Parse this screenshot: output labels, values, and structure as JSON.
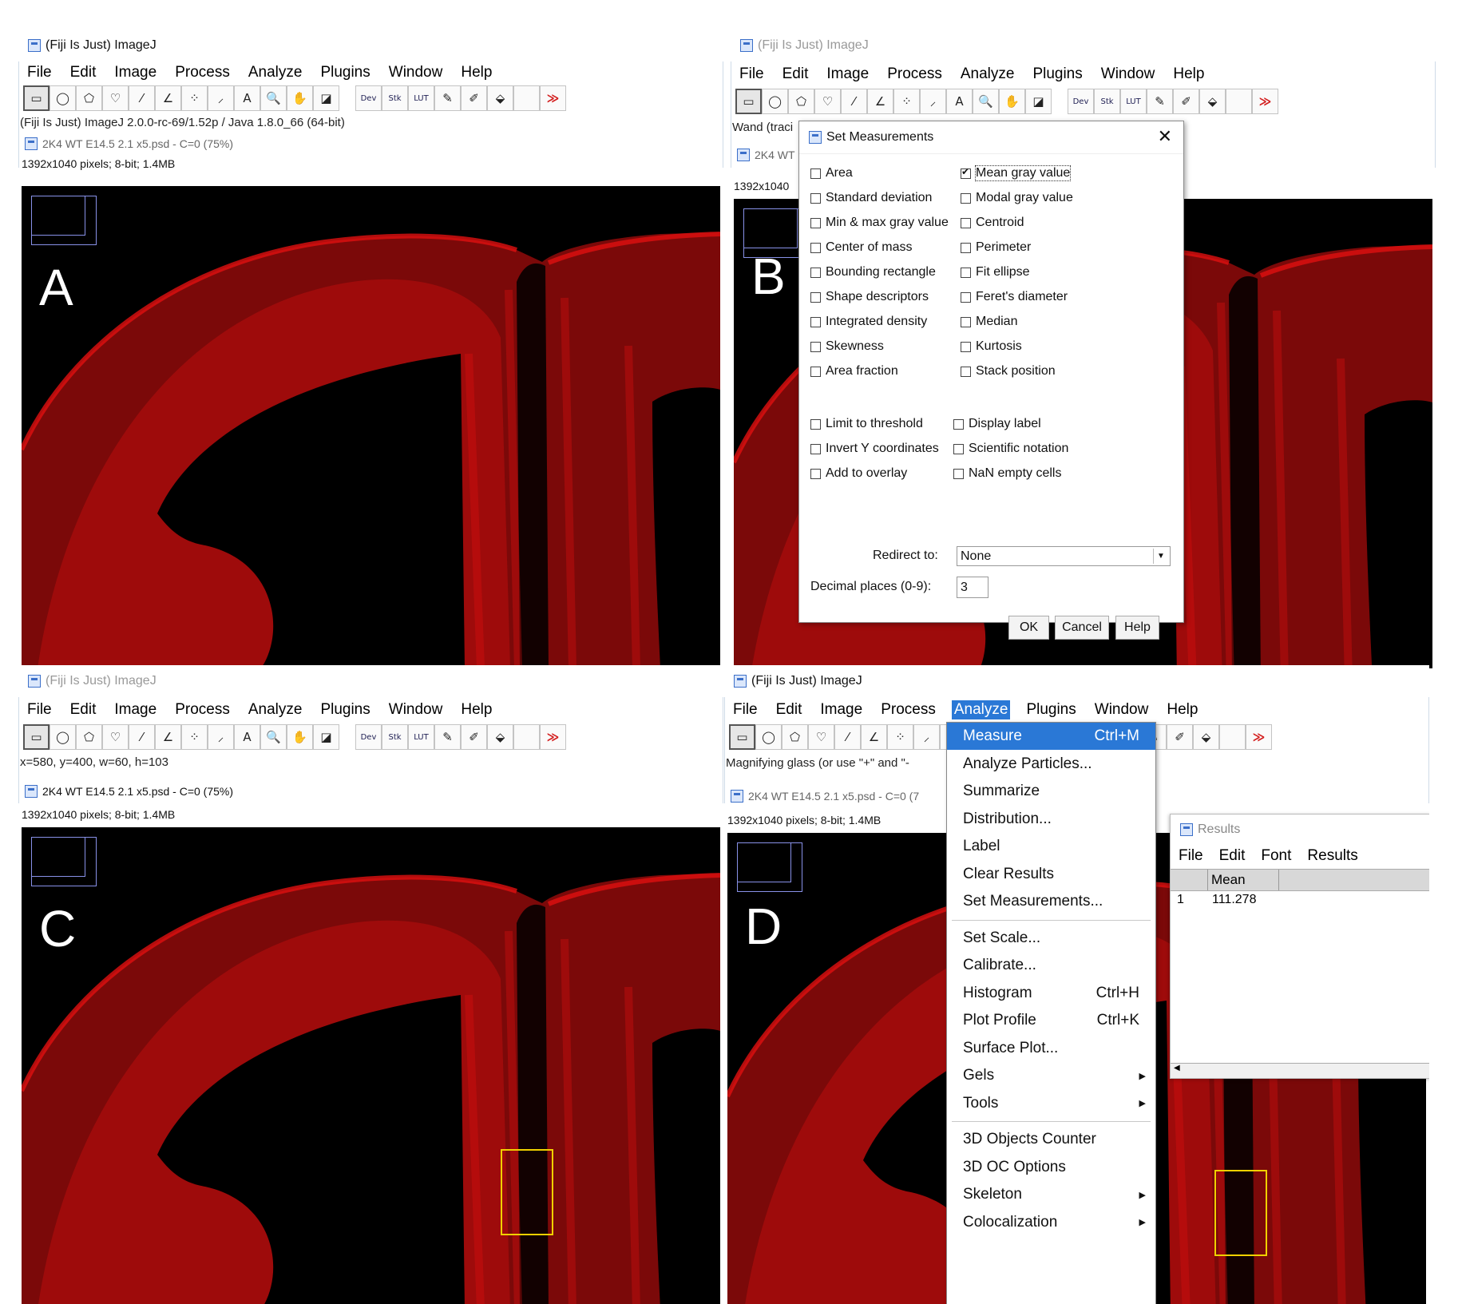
{
  "app_title": "(Fiji Is Just) ImageJ",
  "menus": [
    "File",
    "Edit",
    "Image",
    "Process",
    "Analyze",
    "Plugins",
    "Window",
    "Help"
  ],
  "tools": {
    "rect": "▭",
    "oval": "◯",
    "polygon": "⬠",
    "freehand": "♡",
    "line": "⁄",
    "angle": "∠",
    "point": "⁘",
    "wand": "⸝",
    "text": "A",
    "magnifier": "🔍",
    "hand": "✋",
    "dropper": "◪",
    "dev": "Dev",
    "stk": "Stk",
    "lut": "LUT",
    "pencil": "✎",
    "brush": "✐",
    "flood": "⬙",
    "more": "≫"
  },
  "panel_a": {
    "letter": "A",
    "status": "(Fiji Is Just) ImageJ 2.0.0-rc-69/1.52p / Java 1.8.0_66 (64-bit)",
    "image_title": "2K4 WT E14.5 2.1 x5.psd - C=0 (75%)",
    "image_info": "1392x1040 pixels; 8-bit; 1.4MB"
  },
  "panel_b": {
    "letter": "B",
    "status": "Wand (traci",
    "image_title_fragment": "2K4 WT",
    "image_info_fragment": "1392x1040",
    "dialog": {
      "title": "Set Measurements",
      "left_col": [
        "Area",
        "Standard deviation",
        "Min & max gray value",
        "Center of mass",
        "Bounding rectangle",
        "Shape descriptors",
        "Integrated density",
        "Skewness",
        "Area fraction"
      ],
      "right_col": [
        "Mean gray value",
        "Modal gray value",
        "Centroid",
        "Perimeter",
        "Fit ellipse",
        "Feret's diameter",
        "Median",
        "Kurtosis",
        "Stack position"
      ],
      "left_col2": [
        "Limit to threshold",
        "Invert Y coordinates",
        "Add to overlay"
      ],
      "right_col2": [
        "Display label",
        "Scientific notation",
        "NaN empty cells"
      ],
      "checked": "Mean gray value",
      "redirect_label": "Redirect to:",
      "redirect_value": "None",
      "decimal_label": "Decimal places (0-9):",
      "decimal_value": "3",
      "ok": "OK",
      "cancel": "Cancel",
      "help": "Help"
    }
  },
  "panel_c": {
    "letter": "C",
    "status": "x=580, y=400, w=60, h=103",
    "image_title": "2K4 WT E14.5 2.1 x5.psd - C=0 (75%)",
    "image_info": "1392x1040 pixels; 8-bit; 1.4MB"
  },
  "panel_d": {
    "letter": "D",
    "status": "Magnifying glass (or use \"+\" and \"-",
    "image_title_fragment": "2K4 WT E14.5 2.1 x5.psd - C=0 (7",
    "image_info": "1392x1040 pixels; 8-bit; 1.4MB",
    "analyze_menu": [
      {
        "label": "Measure",
        "shortcut": "Ctrl+M",
        "highlighted": true
      },
      {
        "label": "Analyze Particles..."
      },
      {
        "label": "Summarize"
      },
      {
        "label": "Distribution..."
      },
      {
        "label": "Label"
      },
      {
        "label": "Clear Results"
      },
      {
        "label": "Set Measurements..."
      },
      {
        "label": "Set Scale..."
      },
      {
        "label": "Calibrate..."
      },
      {
        "label": "Histogram",
        "shortcut": "Ctrl+H"
      },
      {
        "label": "Plot Profile",
        "shortcut": "Ctrl+K"
      },
      {
        "label": "Surface Plot..."
      },
      {
        "label": "Gels",
        "submenu": true
      },
      {
        "label": "Tools",
        "submenu": true
      },
      {
        "label": "3D Objects Counter"
      },
      {
        "label": "3D OC Options"
      },
      {
        "label": "Skeleton",
        "submenu": true
      },
      {
        "label": "Colocalization",
        "submenu": true
      }
    ],
    "results": {
      "title": "Results",
      "menu": [
        "File",
        "Edit",
        "Font",
        "Results"
      ],
      "column": "Mean",
      "row_index": "1",
      "row_value": "111.278"
    }
  },
  "colors": {
    "accent": "#2a78d6",
    "tissue": "#e01010",
    "roi": "#f0d000"
  }
}
